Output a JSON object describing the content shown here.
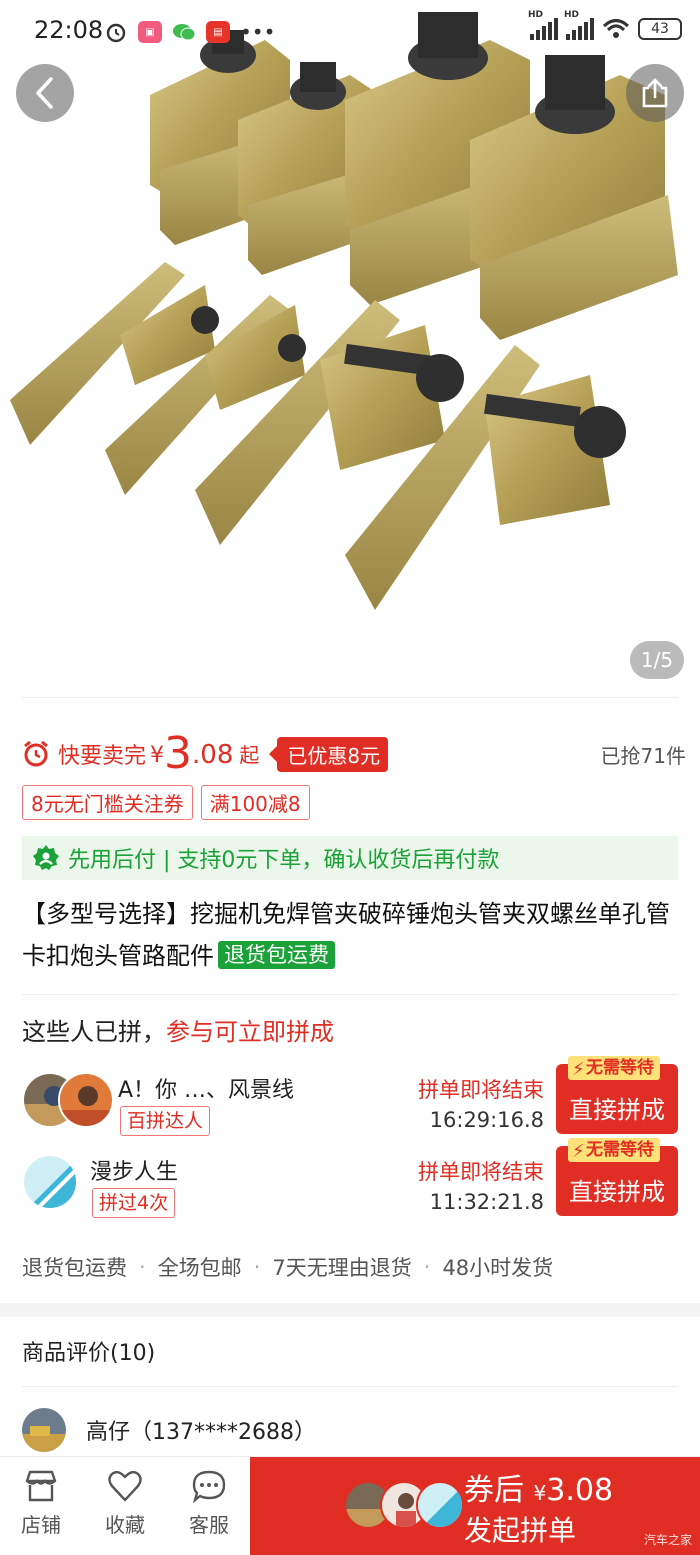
{
  "status_bar": {
    "time": "22:08",
    "battery": "43",
    "network_label": "HD"
  },
  "gallery": {
    "page_indicator": "1/5"
  },
  "price": {
    "urgency": "快要卖完",
    "currency": "¥",
    "integer": "3",
    "decimal": ".08",
    "suffix": "起",
    "discount": "已优惠8元",
    "sold": "已抢71件"
  },
  "coupons": [
    "8元无门槛关注券",
    "满100减8"
  ],
  "paylater": {
    "text": "先用后付 | 支持0元下单，确认收货后再付款"
  },
  "product": {
    "title": "【多型号选择】挖掘机免焊管夹破碎锤炮头管夹双螺丝单孔管卡扣炮头管路配件",
    "badge": "退货包运费"
  },
  "group": {
    "head_plain": "这些人已拼，",
    "head_red": "参与可立即拼成",
    "rows": [
      {
        "name": "A！你 …、风景线",
        "badge": "百拼达人",
        "ending": "拼单即将结束",
        "time": "16:29:16.8",
        "tag": "无需等待",
        "button": "直接拼成"
      },
      {
        "name": "漫步人生",
        "badge": "拼过4次",
        "ending": "拼单即将结束",
        "time": "11:32:21.8",
        "tag": "无需等待",
        "button": "直接拼成"
      }
    ]
  },
  "guarantees": [
    "退货包运费",
    "全场包邮",
    "7天无理由退货",
    "48小时发货"
  ],
  "reviews": {
    "title": "商品评价(10)",
    "first_user": "高仔（137****2688）"
  },
  "bottom_bar": {
    "store": "店铺",
    "favorite": "收藏",
    "service": "客服",
    "buy_prefix": "券后",
    "buy_currency": "¥",
    "buy_price": "3.08",
    "buy_label": "发起拼单",
    "watermark": "汽车之家"
  },
  "colors": {
    "accent_red": "#e02e24",
    "green": "#1aa137",
    "metal": "#b8a45a"
  }
}
